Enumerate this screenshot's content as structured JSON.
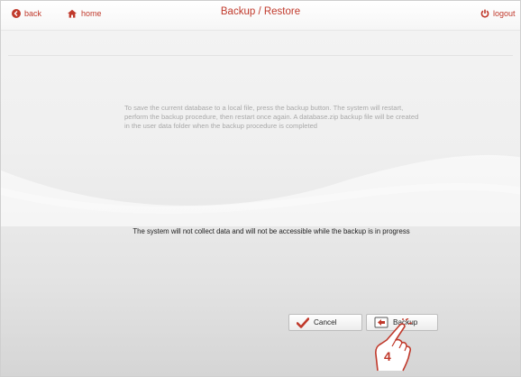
{
  "header": {
    "back_label": "back",
    "home_label": "home",
    "title": "Backup / Restore",
    "logout_label": "logout"
  },
  "main": {
    "info_text": "To save the current database to a local file, press the backup button. The system will restart, perform the backup procedure, then restart once again. A database.zip backup file will be created in the user data folder when the backup procedure is completed",
    "warning_text": "The system will not collect data and will not be accessible while the backup is in progress"
  },
  "buttons": {
    "cancel_label": "Cancel",
    "backup_label": "Backup"
  },
  "annotation": {
    "step_number": "4"
  },
  "colors": {
    "accent": "#c0392b",
    "check": "#c0392b"
  },
  "icons": [
    "back-icon",
    "home-icon",
    "logout-icon",
    "check-icon",
    "backup-icon",
    "pointing-hand-icon"
  ]
}
